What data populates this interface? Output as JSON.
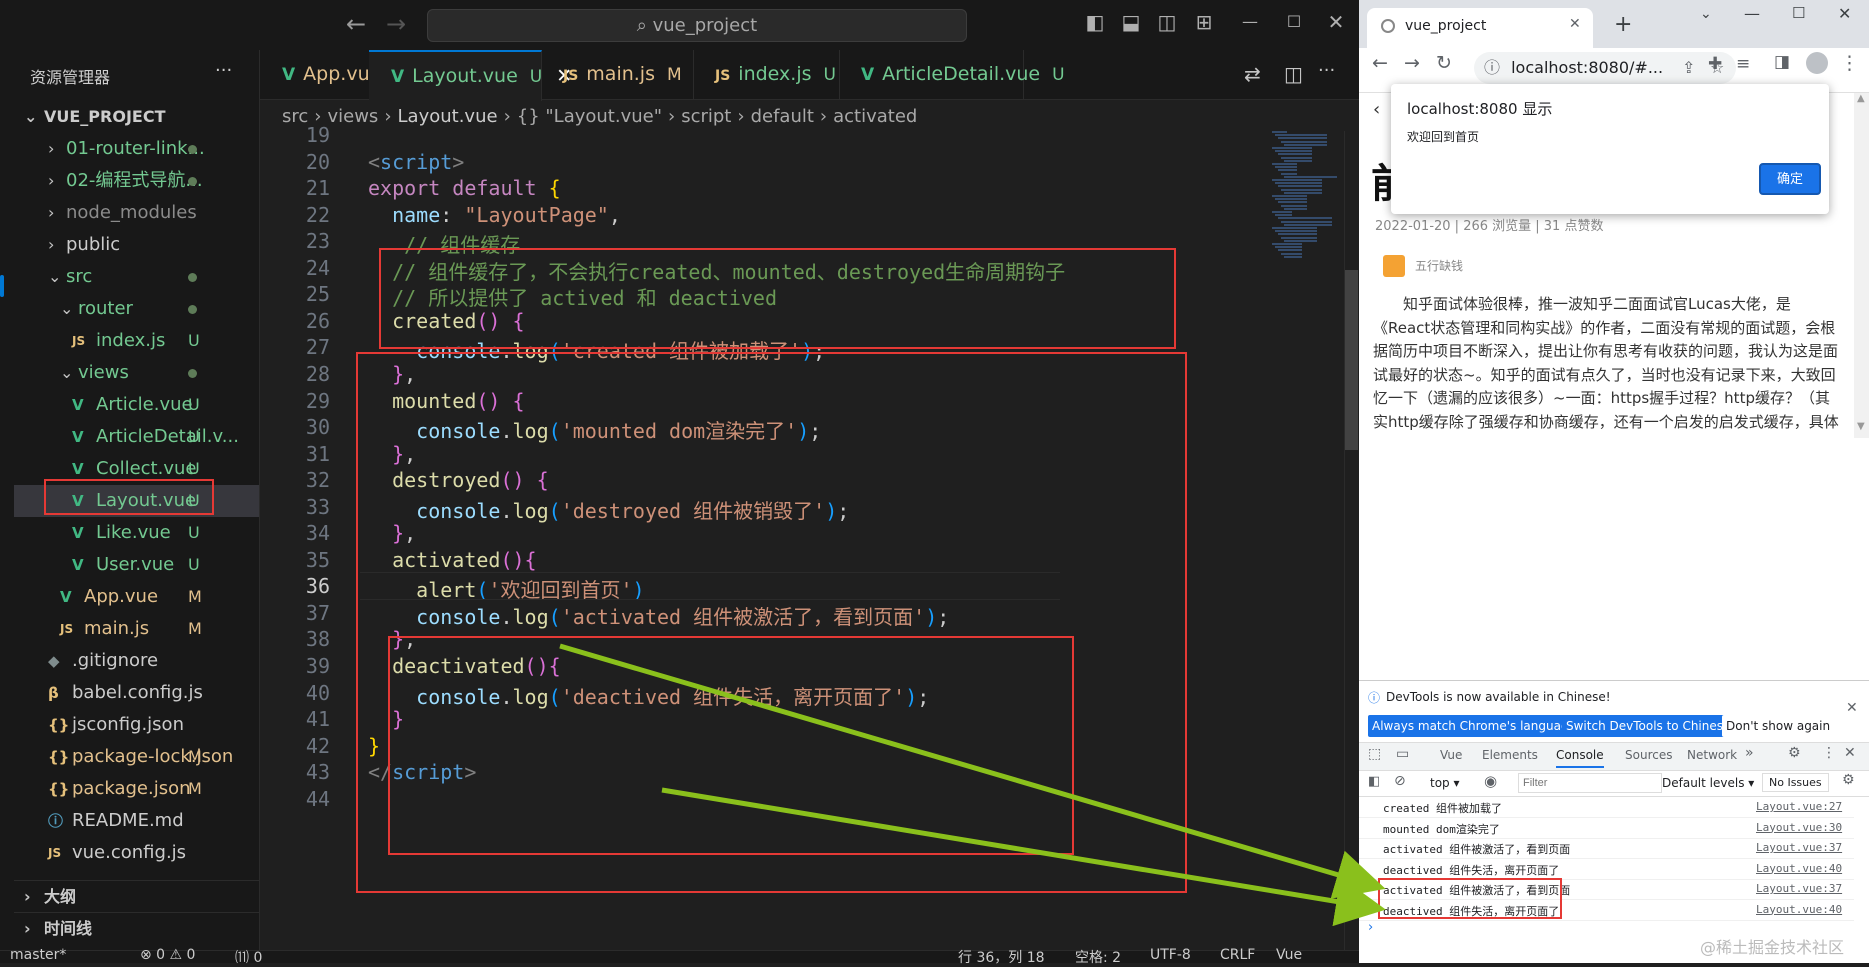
{
  "vscode": {
    "search_text": "vue_project",
    "sidebar_title": "资源管理器",
    "project_name": "VUE_PROJECT",
    "tree": [
      {
        "name": "01-router-link...",
        "badge": "",
        "dot": true,
        "type": "folder",
        "color": "green"
      },
      {
        "name": "02-编程式导航...",
        "badge": "",
        "dot": true,
        "type": "folder",
        "color": "green"
      },
      {
        "name": "node_modules",
        "badge": "",
        "dot": false,
        "type": "folder",
        "color": "dim"
      },
      {
        "name": "public",
        "badge": "",
        "dot": false,
        "type": "folder",
        "color": "normal"
      },
      {
        "name": "src",
        "badge": "",
        "dot": true,
        "type": "folder-open",
        "color": "green"
      },
      {
        "name": "router",
        "badge": "",
        "dot": true,
        "type": "folder-open",
        "color": "green"
      },
      {
        "name": "index.js",
        "badge": "U",
        "type": "js",
        "color": "green"
      },
      {
        "name": "views",
        "badge": "",
        "dot": true,
        "type": "folder-open",
        "color": "green"
      },
      {
        "name": "Article.vue",
        "badge": "U",
        "type": "vue",
        "color": "green"
      },
      {
        "name": "ArticleDetail.v...",
        "badge": "U",
        "type": "vue",
        "color": "green"
      },
      {
        "name": "Collect.vue",
        "badge": "U",
        "type": "vue",
        "color": "green"
      },
      {
        "name": "Layout.vue",
        "badge": "U",
        "type": "vue",
        "color": "green"
      },
      {
        "name": "Like.vue",
        "badge": "U",
        "type": "vue",
        "color": "green"
      },
      {
        "name": "User.vue",
        "badge": "U",
        "type": "vue",
        "color": "green"
      },
      {
        "name": "App.vue",
        "badge": "M",
        "type": "vue",
        "color": "yellow"
      },
      {
        "name": "main.js",
        "badge": "M",
        "type": "js",
        "color": "yellow"
      },
      {
        "name": ".gitignore",
        "badge": "",
        "type": "git",
        "color": "normal"
      },
      {
        "name": "babel.config.js",
        "badge": "",
        "type": "babel",
        "color": "normal"
      },
      {
        "name": "jsconfig.json",
        "badge": "",
        "type": "json",
        "color": "normal"
      },
      {
        "name": "package-lock.json",
        "badge": "M",
        "type": "json",
        "color": "yellow"
      },
      {
        "name": "package.json",
        "badge": "M",
        "type": "json",
        "color": "yellow"
      },
      {
        "name": "README.md",
        "badge": "",
        "type": "info",
        "color": "normal"
      },
      {
        "name": "vue.config.js",
        "badge": "",
        "type": "js",
        "color": "normal"
      }
    ],
    "outline_label": "大纲",
    "timeline_label": "时间线",
    "tabs": [
      {
        "icon": "V",
        "name": "App.vue",
        "badge": "M"
      },
      {
        "icon": "V",
        "name": "Layout.vue",
        "badge": "U",
        "close": "✕"
      },
      {
        "icon": "JS",
        "name": "main.js",
        "badge": "M"
      },
      {
        "icon": "JS",
        "name": "index.js",
        "badge": "U"
      },
      {
        "icon": "V",
        "name": "ArticleDetail.vue",
        "badge": "U"
      }
    ],
    "breadcrumb": [
      "src",
      "›",
      "views",
      "›",
      "Layout.vue",
      "›",
      "{} \"Layout.vue\"",
      "›",
      "script",
      "›",
      "default",
      "›",
      "activated"
    ],
    "status": {
      "branch": "master*",
      "errors": "⊗ 0 ⚠ 0",
      "ports": "⑾ 0",
      "line_col": "行 36，列 18",
      "spaces": "空格: 2",
      "encoding": "UTF-8",
      "eol": "CRLF",
      "lang": "Vue"
    }
  },
  "code_lines": [
    {
      "n": "19",
      "segs": []
    },
    {
      "n": "20",
      "segs": [
        [
          "k-tag",
          "<"
        ],
        [
          "k-tagn",
          "script"
        ],
        [
          "k-tag",
          ">"
        ]
      ]
    },
    {
      "n": "21",
      "segs": [
        [
          "k-kw",
          "export default "
        ],
        [
          "k-br1",
          "{"
        ]
      ]
    },
    {
      "n": "22",
      "segs": [
        [
          "",
          "  "
        ],
        [
          "k-prop",
          "name"
        ],
        [
          "",
          ": "
        ],
        [
          "k-str",
          "\"LayoutPage\""
        ],
        [
          "",
          ","
        ]
      ]
    },
    {
      "n": "23",
      "segs": [
        [
          "",
          "   "
        ],
        [
          "k-cmt",
          "// 组件缓存"
        ]
      ]
    },
    {
      "n": "24",
      "segs": [
        [
          "",
          "  "
        ],
        [
          "k-cmt",
          "// 组件缓存了，不会执行created、mounted、destroyed生命周期钩子"
        ]
      ]
    },
    {
      "n": "25",
      "segs": [
        [
          "",
          "  "
        ],
        [
          "k-cmt",
          "// 所以提供了 actived 和 deactived"
        ]
      ]
    },
    {
      "n": "26",
      "segs": [
        [
          "",
          "  "
        ],
        [
          "k-fn",
          "created"
        ],
        [
          "k-br2",
          "()"
        ],
        [
          "",
          " "
        ],
        [
          "k-br2",
          "{"
        ]
      ]
    },
    {
      "n": "27",
      "segs": [
        [
          "",
          "    "
        ],
        [
          "k-prop",
          "console"
        ],
        [
          "",
          "."
        ],
        [
          "k-fn",
          "log"
        ],
        [
          "k-br3",
          "("
        ],
        [
          "k-str",
          "'created 组件被加载了'"
        ],
        [
          "k-br3",
          ")"
        ],
        [
          "",
          ";"
        ]
      ]
    },
    {
      "n": "28",
      "segs": [
        [
          "",
          "  "
        ],
        [
          "k-br2",
          "}"
        ],
        [
          "",
          ","
        ]
      ]
    },
    {
      "n": "29",
      "segs": [
        [
          "",
          "  "
        ],
        [
          "k-fn",
          "mounted"
        ],
        [
          "k-br2",
          "()"
        ],
        [
          "",
          " "
        ],
        [
          "k-br2",
          "{"
        ]
      ]
    },
    {
      "n": "30",
      "segs": [
        [
          "",
          "    "
        ],
        [
          "k-prop",
          "console"
        ],
        [
          "",
          "."
        ],
        [
          "k-fn",
          "log"
        ],
        [
          "k-br3",
          "("
        ],
        [
          "k-str",
          "'mounted dom渲染完了'"
        ],
        [
          "k-br3",
          ")"
        ],
        [
          "",
          ";"
        ]
      ]
    },
    {
      "n": "31",
      "segs": [
        [
          "",
          "  "
        ],
        [
          "k-br2",
          "}"
        ],
        [
          "",
          ","
        ]
      ]
    },
    {
      "n": "32",
      "segs": [
        [
          "",
          "  "
        ],
        [
          "k-fn",
          "destroyed"
        ],
        [
          "k-br2",
          "()"
        ],
        [
          "",
          " "
        ],
        [
          "k-br2",
          "{"
        ]
      ]
    },
    {
      "n": "33",
      "segs": [
        [
          "",
          "    "
        ],
        [
          "k-prop",
          "console"
        ],
        [
          "",
          "."
        ],
        [
          "k-fn",
          "log"
        ],
        [
          "k-br3",
          "("
        ],
        [
          "k-str",
          "'destroyed 组件被销毁了'"
        ],
        [
          "k-br3",
          ")"
        ],
        [
          "",
          ";"
        ]
      ]
    },
    {
      "n": "34",
      "segs": [
        [
          "",
          "  "
        ],
        [
          "k-br2",
          "}"
        ],
        [
          "",
          ","
        ]
      ]
    },
    {
      "n": "35",
      "segs": [
        [
          "",
          "  "
        ],
        [
          "k-fn",
          "activated"
        ],
        [
          "k-br2",
          "(){"
        ]
      ]
    },
    {
      "n": "36",
      "segs": [
        [
          "",
          "    "
        ],
        [
          "k-fn",
          "alert"
        ],
        [
          "k-br3",
          "("
        ],
        [
          "k-str",
          "'欢迎回到首页'"
        ],
        [
          "k-br3",
          ")"
        ]
      ]
    },
    {
      "n": "37",
      "segs": [
        [
          "",
          "    "
        ],
        [
          "k-prop",
          "console"
        ],
        [
          "",
          "."
        ],
        [
          "k-fn",
          "log"
        ],
        [
          "k-br3",
          "("
        ],
        [
          "k-str",
          "'activated 组件被激活了，看到页面'"
        ],
        [
          "k-br3",
          ")"
        ],
        [
          "",
          ";"
        ]
      ]
    },
    {
      "n": "38",
      "segs": [
        [
          "",
          "  "
        ],
        [
          "k-br2",
          "}"
        ],
        [
          "",
          ","
        ]
      ]
    },
    {
      "n": "39",
      "segs": [
        [
          "",
          "  "
        ],
        [
          "k-fn",
          "deactivated"
        ],
        [
          "k-br2",
          "(){"
        ]
      ]
    },
    {
      "n": "40",
      "segs": [
        [
          "",
          "    "
        ],
        [
          "k-prop",
          "console"
        ],
        [
          "",
          "."
        ],
        [
          "k-fn",
          "log"
        ],
        [
          "k-br3",
          "("
        ],
        [
          "k-str",
          "'deactived 组件失活，离开页面了'"
        ],
        [
          "k-br3",
          ")"
        ],
        [
          "",
          ";"
        ]
      ]
    },
    {
      "n": "41",
      "segs": [
        [
          "",
          "  "
        ],
        [
          "k-br2",
          "}"
        ]
      ]
    },
    {
      "n": "42",
      "segs": [
        [
          "k-br1",
          "}"
        ]
      ]
    },
    {
      "n": "43",
      "segs": [
        [
          "k-tag",
          "</"
        ],
        [
          "k-tagn",
          "script"
        ],
        [
          "k-tag",
          ">"
        ]
      ]
    },
    {
      "n": "44",
      "segs": []
    }
  ],
  "chrome": {
    "tab_title": "vue_project",
    "url": "localhost:8080/#...",
    "dialog_title": "localhost:8080 显示",
    "dialog_message": "欢迎回到首页",
    "dialog_ok": "确定",
    "article_heading_char": "前",
    "article_meta": "2022-01-20 | 266 浏览量 | 31 点赞数",
    "author": "五行缺钱",
    "article_text": "知乎面试体验很棒，推一波知乎二面面试官Lucas大佬，是《React状态管理和同构实战》的作者，二面没有常规的面试题，会根据简历中项目不断深入，提出让你有思考有收获的问题，我认为这是面试最好的状态~。知乎的面试有点久了，当时也没有记录下来，大致回忆一下（遗漏的应该很多）~一面：https握手过程？http缓存？（其实http缓存除了强缓存和协商缓存，还有一个启发的启发式缓存，具体可以查查r"
  },
  "devtools": {
    "notice": "DevTools is now available in Chinese!",
    "btn_match": "Always match Chrome's language",
    "btn_switch": "Switch DevTools to Chinese",
    "btn_dont": "Don't show again",
    "tabs": [
      "Vue",
      "Elements",
      "Console",
      "Sources",
      "Network"
    ],
    "context": "top",
    "filter_placeholder": "Filter",
    "levels": "Default levels",
    "issues": "No Issues",
    "logs": [
      {
        "msg": "created 组件被加载了",
        "src": "Layout.vue:27"
      },
      {
        "msg": "mounted dom渲染完了",
        "src": "Layout.vue:30"
      },
      {
        "msg": "activated 组件被激活了，看到页面",
        "src": "Layout.vue:37"
      },
      {
        "msg": "deactived 组件失活，离开页面了",
        "src": "Layout.vue:40"
      },
      {
        "msg": "activated 组件被激活了，看到页面",
        "src": "Layout.vue:37"
      },
      {
        "msg": "deactived 组件失活，离开页面了",
        "src": "Layout.vue:40"
      }
    ]
  },
  "watermark": "@稀土掘金技术社区"
}
